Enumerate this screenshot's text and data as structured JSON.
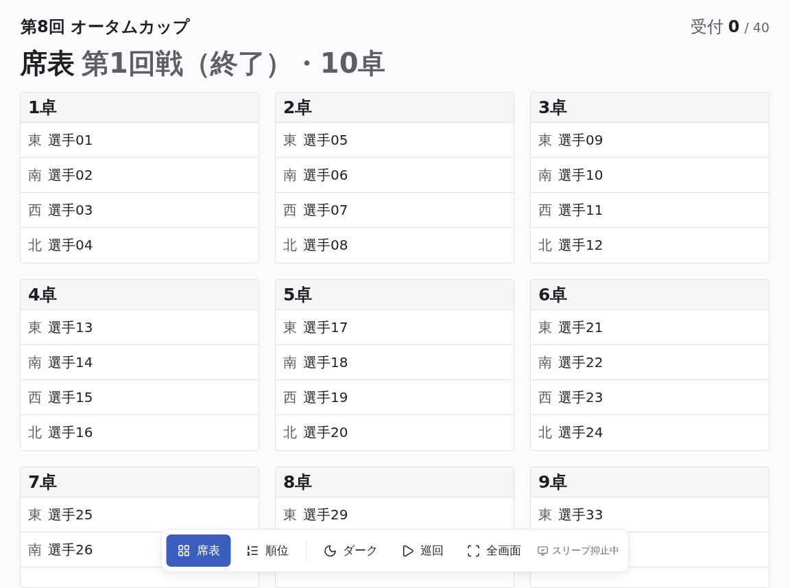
{
  "event": {
    "title": "第8回 オータムカップ",
    "reception": {
      "label": "受付",
      "count": "0",
      "total": "/ 40"
    }
  },
  "heading": {
    "title": "席表",
    "subtitle": "第1回戦（終了）・10卓"
  },
  "tables": [
    {
      "name": "1卓",
      "seats": [
        {
          "wind": "東",
          "player": "選手01"
        },
        {
          "wind": "南",
          "player": "選手02"
        },
        {
          "wind": "西",
          "player": "選手03"
        },
        {
          "wind": "北",
          "player": "選手04"
        }
      ]
    },
    {
      "name": "2卓",
      "seats": [
        {
          "wind": "東",
          "player": "選手05"
        },
        {
          "wind": "南",
          "player": "選手06"
        },
        {
          "wind": "西",
          "player": "選手07"
        },
        {
          "wind": "北",
          "player": "選手08"
        }
      ]
    },
    {
      "name": "3卓",
      "seats": [
        {
          "wind": "東",
          "player": "選手09"
        },
        {
          "wind": "南",
          "player": "選手10"
        },
        {
          "wind": "西",
          "player": "選手11"
        },
        {
          "wind": "北",
          "player": "選手12"
        }
      ]
    },
    {
      "name": "4卓",
      "seats": [
        {
          "wind": "東",
          "player": "選手13"
        },
        {
          "wind": "南",
          "player": "選手14"
        },
        {
          "wind": "西",
          "player": "選手15"
        },
        {
          "wind": "北",
          "player": "選手16"
        }
      ]
    },
    {
      "name": "5卓",
      "seats": [
        {
          "wind": "東",
          "player": "選手17"
        },
        {
          "wind": "南",
          "player": "選手18"
        },
        {
          "wind": "西",
          "player": "選手19"
        },
        {
          "wind": "北",
          "player": "選手20"
        }
      ]
    },
    {
      "name": "6卓",
      "seats": [
        {
          "wind": "東",
          "player": "選手21"
        },
        {
          "wind": "南",
          "player": "選手22"
        },
        {
          "wind": "西",
          "player": "選手23"
        },
        {
          "wind": "北",
          "player": "選手24"
        }
      ]
    },
    {
      "name": "7卓",
      "seats": [
        {
          "wind": "東",
          "player": "選手25"
        },
        {
          "wind": "南",
          "player": "選手26"
        }
      ]
    },
    {
      "name": "8卓",
      "seats": [
        {
          "wind": "東",
          "player": "選手29"
        }
      ]
    },
    {
      "name": "9卓",
      "seats": [
        {
          "wind": "東",
          "player": "選手33"
        }
      ]
    }
  ],
  "toolbar": {
    "views": [
      {
        "label": "席表",
        "selected": true
      },
      {
        "label": "順位",
        "selected": false
      }
    ],
    "actions": [
      {
        "label": "ダーク"
      },
      {
        "label": "巡回"
      },
      {
        "label": "全画面"
      }
    ],
    "status": {
      "label": "スリープ抑止中"
    }
  }
}
